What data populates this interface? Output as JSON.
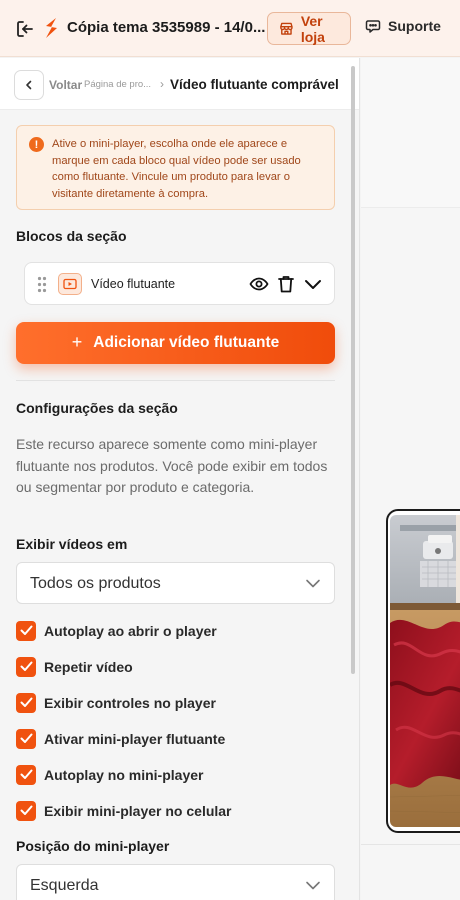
{
  "header": {
    "theme_title": "Cópia tema 3535989 - 14/0...",
    "view_store_label": "Ver loja",
    "support_label": "Suporte"
  },
  "breadcrumb": {
    "back_label": "Voltar",
    "parent_label": "Página de pro...",
    "separator": "›",
    "current_label": "Vídeo flutuante comprável"
  },
  "info_notice": {
    "icon": "!",
    "text": "Ative o mini-player, escolha onde ele aparece e marque em cada bloco qual vídeo pode ser usado como flutuante. Vincule um produto para levar o visitante diretamente à compra."
  },
  "blocks_section": {
    "title": "Blocos da seção",
    "blocks": [
      {
        "label": "Vídeo flutuante"
      }
    ],
    "add_button_icon": "+",
    "add_button_label": "Adicionar vídeo flutuante"
  },
  "settings": {
    "title": "Configurações da seção",
    "description": "Este recurso aparece somente como mini-player flutuante nos produtos. Você pode exibir em todos ou segmentar por produto e categoria.",
    "display_label": "Exibir vídeos em",
    "display_value": "Todos os produtos",
    "checkboxes": [
      {
        "label": "Autoplay ao abrir o player",
        "checked": true
      },
      {
        "label": "Repetir vídeo",
        "checked": true
      },
      {
        "label": "Exibir controles no player",
        "checked": true
      },
      {
        "label": "Ativar mini-player flutuante",
        "checked": true
      },
      {
        "label": "Autoplay no mini-player",
        "checked": true
      },
      {
        "label": "Exibir mini-player no celular",
        "checked": true
      }
    ],
    "position_label": "Posição do mini-player",
    "position_value": "Esquerda"
  },
  "colors": {
    "accent": "#f0520f",
    "header_bg": "#fdf2ec",
    "notice_bg": "#fdf1e6",
    "notice_text": "#a0471a"
  }
}
